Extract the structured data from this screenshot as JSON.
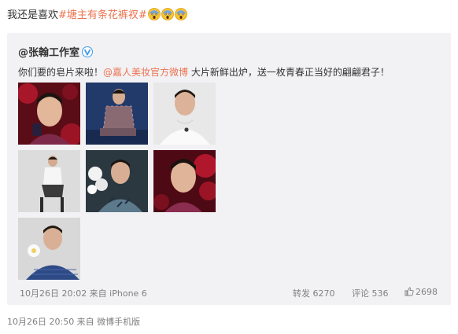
{
  "post": {
    "text_before": "我还是喜欢",
    "topic": "#塘主有条花裤衩#",
    "emojis": [
      "scream-emoji",
      "scream-emoji",
      "scream-emoji"
    ],
    "footer": "10月26日 20:50 来自 微博手机版"
  },
  "repost": {
    "author": "@张翰工作室",
    "verified_icon": "verified-v-icon",
    "text_before": "你们要的皂片来啦！",
    "mention": "@嘉人美妆官方微博",
    "text_after": " 大片新鲜出炉，送一枚青春正当好的翩翩君子！",
    "photos": [
      {
        "name": "photo-1",
        "scene": "red-roses-portrait"
      },
      {
        "name": "photo-2",
        "scene": "plaid-suit-seated"
      },
      {
        "name": "photo-3",
        "scene": "white-shirt-portrait"
      },
      {
        "name": "photo-4",
        "scene": "stool-seated-full-body"
      },
      {
        "name": "photo-5",
        "scene": "white-flowers-patterned-jacket"
      },
      {
        "name": "photo-6",
        "scene": "red-roses-closeup"
      },
      {
        "name": "photo-7",
        "scene": "blue-sweater-white-flower"
      }
    ],
    "meta": {
      "time_source": "10月26日 20:02 来自 iPhone 6",
      "repost_label": "转发 6270",
      "comment_label": "评论 536",
      "like_count": "2698",
      "like_icon": "thumbs-up-icon"
    }
  },
  "colors": {
    "accent": "#eb7350",
    "repost_bg": "#f2f2f5",
    "meta_text": "#808080",
    "body_text": "#333333"
  }
}
